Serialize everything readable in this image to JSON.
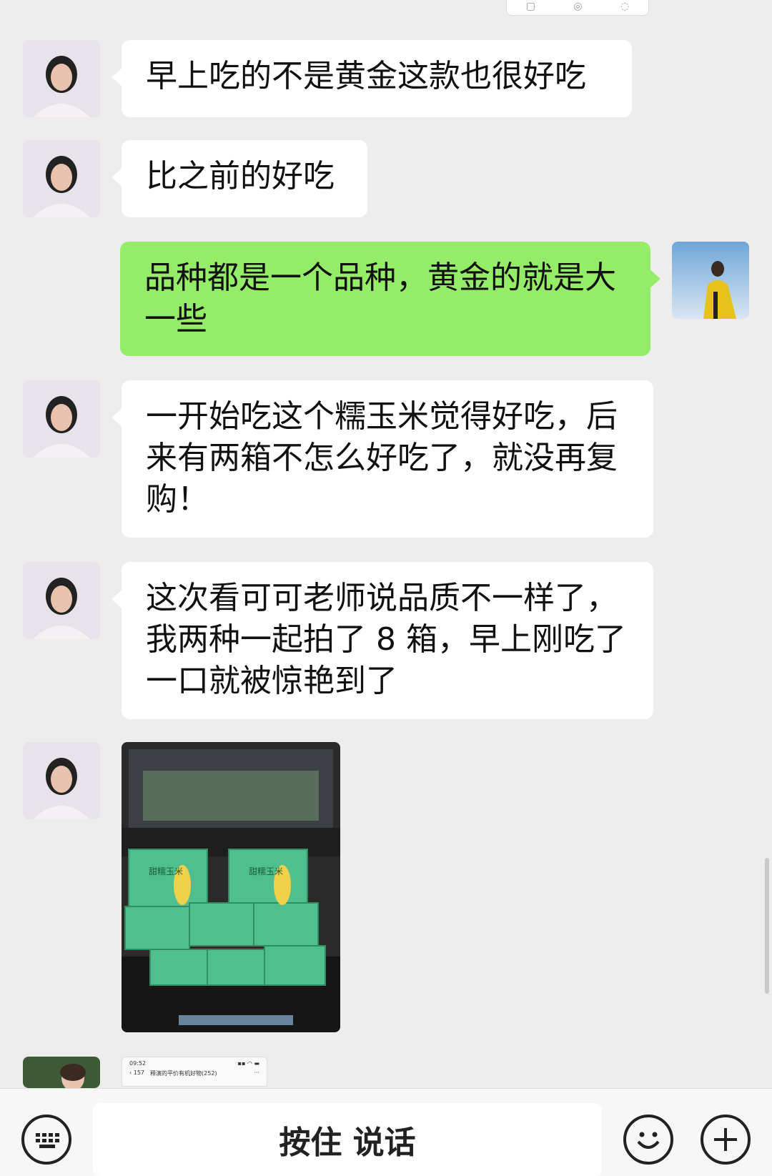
{
  "messages": [
    {
      "side": "left",
      "text": "早上吃的不是黄金这款也很好吃"
    },
    {
      "side": "left",
      "text": "比之前的好吃"
    },
    {
      "side": "right",
      "text": "品种都是一个品种，黄金的就是大\n一些"
    },
    {
      "side": "left",
      "text": "一开始吃这个糯玉米觉得好吃，后\n来有两箱不怎么好吃了，就没再复\n购！"
    },
    {
      "side": "left",
      "text": "这次看可可老师说品质不一样了，\n我两种一起拍了 8 箱，早上刚吃了\n一口就被惊艳到了"
    }
  ],
  "photo": {
    "box_label": "甜糯玉米"
  },
  "preview": {
    "time": "09:52",
    "back_count": "157",
    "chat_title": "释演的平价有机好物(252)"
  },
  "bottom_bar": {
    "voice_label": "按住 说话",
    "keyboard_icon": "keyboard-icon",
    "emoji_icon": "emoji-icon",
    "plus_icon": "plus-icon"
  },
  "colors": {
    "background": "#ededed",
    "left_bubble": "#ffffff",
    "right_bubble": "#95ec69"
  }
}
